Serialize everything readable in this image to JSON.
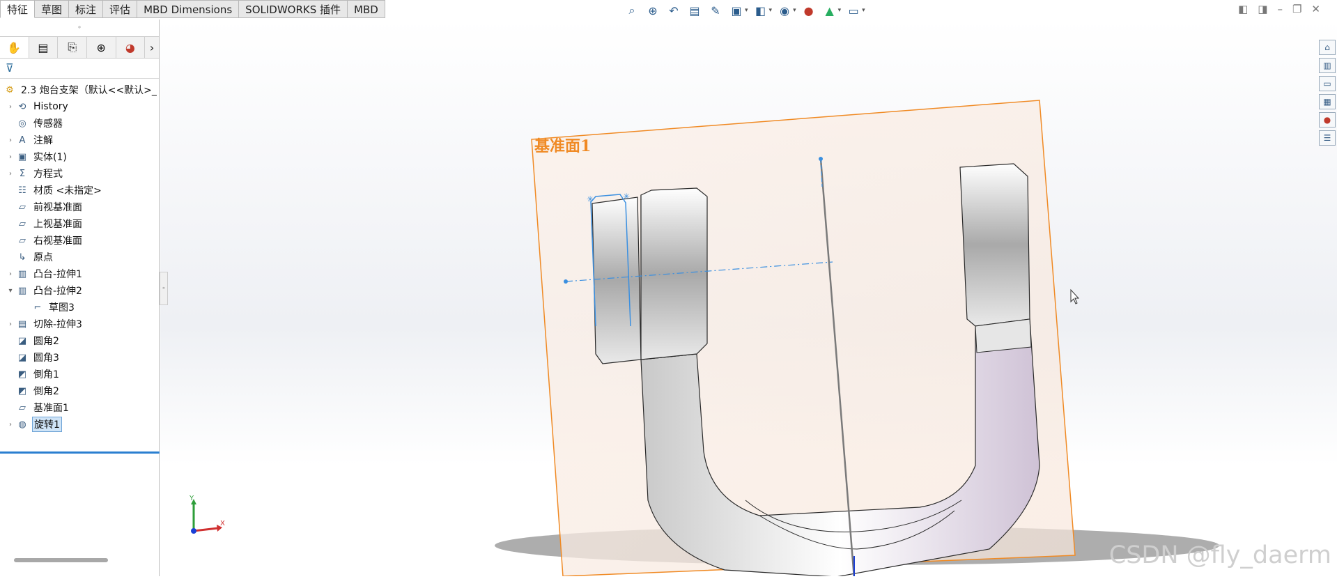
{
  "ribbon": {
    "tabs": [
      "特征",
      "草图",
      "标注",
      "评估",
      "MBD Dimensions",
      "SOLIDWORKS 插件",
      "MBD"
    ],
    "active_tab": "特征"
  },
  "view_toolbar": {
    "icons": [
      "zoom-to-fit-icon",
      "zoom-area-icon",
      "previous-view-icon",
      "section-view-icon",
      "dynamic-annotation-icon",
      "view-orientation-icon",
      "display-style-icon",
      "hide-show-icon",
      "edit-appearance-icon",
      "scene-icon",
      "view-settings-icon"
    ]
  },
  "sidebar": {
    "tree_root": "2.3 炮台支架（默认<<默认>_",
    "items": [
      {
        "label": "History",
        "icon": "history-icon",
        "expandable": true
      },
      {
        "label": "传感器",
        "icon": "sensor-icon",
        "expandable": false
      },
      {
        "label": "注解",
        "icon": "annotation-icon",
        "expandable": true
      },
      {
        "label": "实体(1)",
        "icon": "solid-body-icon",
        "expandable": true
      },
      {
        "label": "方程式",
        "icon": "equation-icon",
        "expandable": true
      },
      {
        "label": "材质 <未指定>",
        "icon": "material-icon",
        "expandable": false
      },
      {
        "label": "前视基准面",
        "icon": "plane-icon",
        "expandable": false
      },
      {
        "label": "上视基准面",
        "icon": "plane-icon",
        "expandable": false
      },
      {
        "label": "右视基准面",
        "icon": "plane-icon",
        "expandable": false
      },
      {
        "label": "原点",
        "icon": "origin-icon",
        "expandable": false
      },
      {
        "label": "凸台-拉伸1",
        "icon": "extrude-icon",
        "expandable": true
      },
      {
        "label": "凸台-拉伸2",
        "icon": "extrude-icon",
        "expandable": true,
        "expanded": true
      },
      {
        "label": "草图3",
        "icon": "sketch-icon",
        "expandable": false,
        "indent": 1
      },
      {
        "label": "切除-拉伸3",
        "icon": "cut-extrude-icon",
        "expandable": true
      },
      {
        "label": "圆角2",
        "icon": "fillet-icon",
        "expandable": false
      },
      {
        "label": "圆角3",
        "icon": "fillet-icon",
        "expandable": false
      },
      {
        "label": "倒角1",
        "icon": "chamfer-icon",
        "expandable": false
      },
      {
        "label": "倒角2",
        "icon": "chamfer-icon",
        "expandable": false
      },
      {
        "label": "基准面1",
        "icon": "plane-icon",
        "expandable": false
      },
      {
        "label": "旋转1",
        "icon": "revolve-icon",
        "expandable": true,
        "selected": true
      }
    ]
  },
  "viewport": {
    "plane_label": "基准面1",
    "triad_x": "X",
    "triad_y": "Y",
    "plane_color": "#f08a24",
    "sketch_color": "#3a8fe0"
  },
  "watermark": "CSDN @fly_daerm"
}
